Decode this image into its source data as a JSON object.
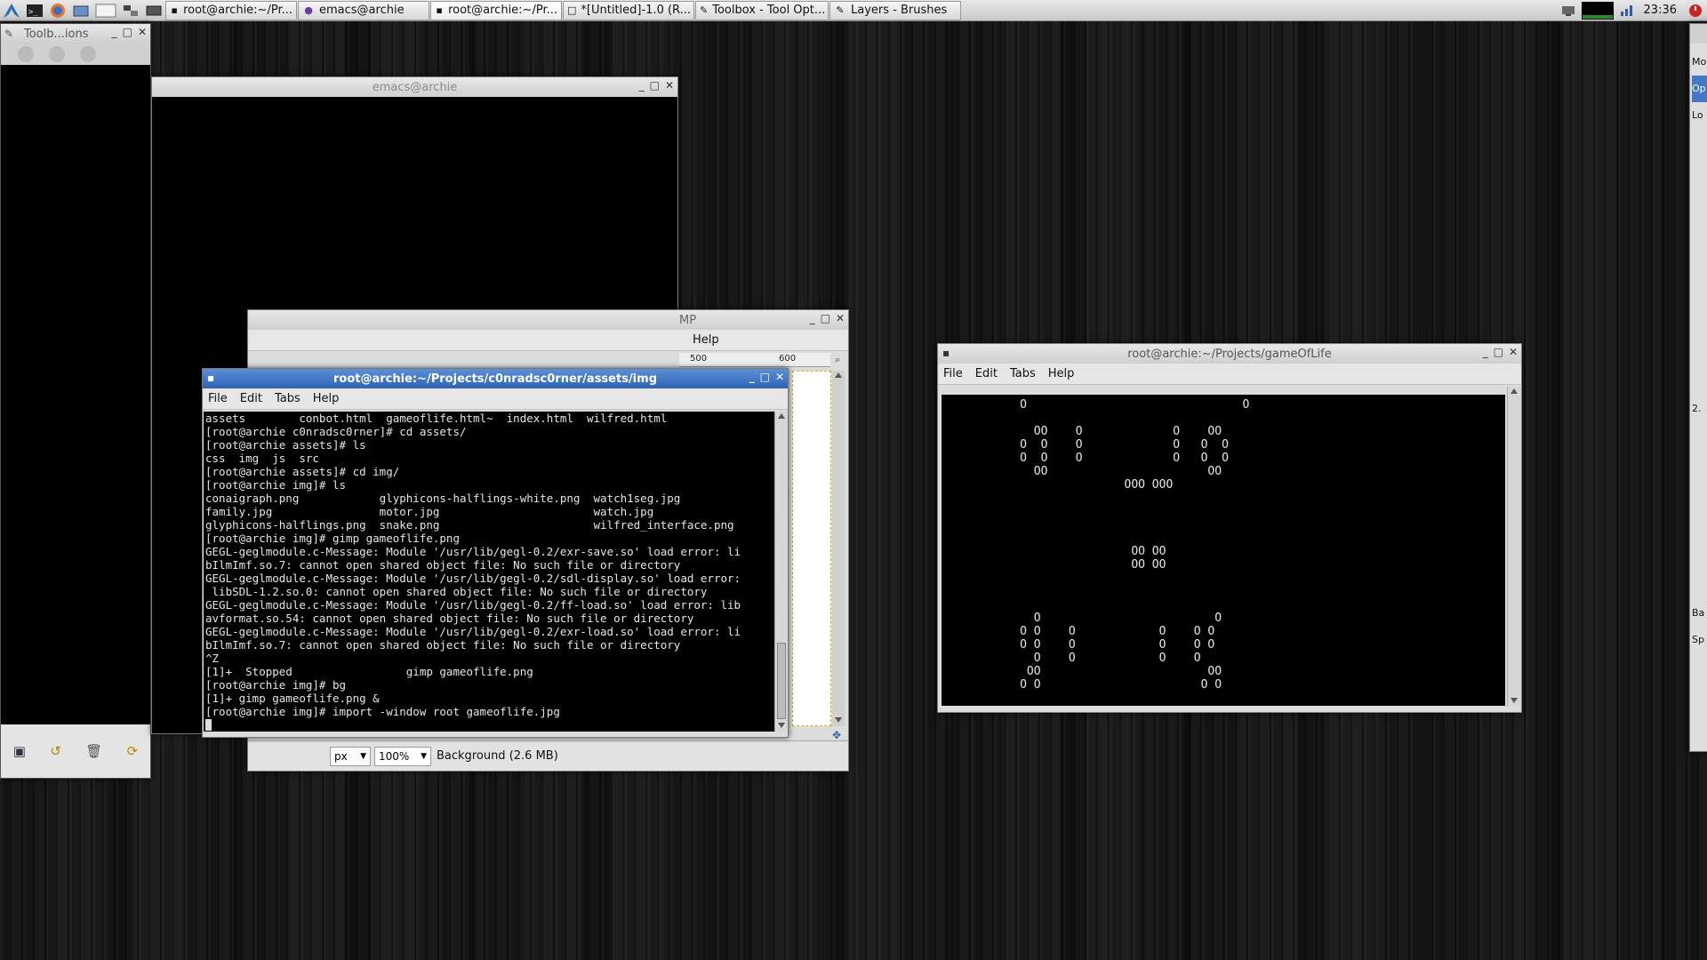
{
  "taskbar": {
    "tasks": [
      {
        "label": "root@archie:~/Pr..."
      },
      {
        "label": "emacs@archie"
      },
      {
        "label": "root@archie:~/Pr..."
      },
      {
        "label": "*[Untitled]-1.0 (R..."
      },
      {
        "label": "Toolbox - Tool Opt..."
      },
      {
        "label": "Layers - Brushes"
      }
    ],
    "clock": "23:36"
  },
  "toolbox_window": {
    "title": "Toolb...ions"
  },
  "emacs_window": {
    "title": "emacs@archie"
  },
  "gimp_partial": {
    "title": "MP",
    "menu_help": "Help",
    "ruler": [
      "500",
      "600"
    ],
    "unit": "px",
    "zoom": "100%",
    "layer_info": "Background (2.6 MB)"
  },
  "terminal_assets": {
    "title": "root@archie:~/Projects/c0nradsc0rner/assets/img",
    "menu": [
      "File",
      "Edit",
      "Tabs",
      "Help"
    ],
    "lines": [
      "assets        conbot.html  gameoflife.html~  index.html  wilfred.html",
      "[root@archie c0nradsc0rner]# cd assets/",
      "[root@archie assets]# ls",
      "css  img  js  src",
      "[root@archie assets]# cd img/",
      "[root@archie img]# ls",
      "conaigraph.png            glyphicons-halflings-white.png  watch1seg.jpg",
      "family.jpg                motor.jpg                       watch.jpg",
      "glyphicons-halflings.png  snake.png                       wilfred_interface.png",
      "[root@archie img]# gimp gameoflife.png",
      "GEGL-geglmodule.c-Message: Module '/usr/lib/gegl-0.2/exr-save.so' load error: li",
      "bIlmImf.so.7: cannot open shared object file: No such file or directory",
      "GEGL-geglmodule.c-Message: Module '/usr/lib/gegl-0.2/sdl-display.so' load error:",
      " libSDL-1.2.so.0: cannot open shared object file: No such file or directory",
      "GEGL-geglmodule.c-Message: Module '/usr/lib/gegl-0.2/ff-load.so' load error: lib",
      "avformat.so.54: cannot open shared object file: No such file or directory",
      "GEGL-geglmodule.c-Message: Module '/usr/lib/gegl-0.2/exr-load.so' load error: li",
      "bIlmImf.so.7: cannot open shared object file: No such file or directory",
      "^Z",
      "[1]+  Stopped                 gimp gameoflife.png",
      "[root@archie img]# bg",
      "[1]+ gimp gameoflife.png &",
      "[root@archie img]# import -window root gameoflife.jpg"
    ]
  },
  "terminal_gol": {
    "title": "root@archie:~/Projects/gameOfLife",
    "menu": [
      "File",
      "Edit",
      "Tabs",
      "Help"
    ],
    "lines": [
      "           O                               O",
      "",
      "             OO    O             O    OO",
      "           O  O    O             O   O  O",
      "           O  O    O             O   O  O",
      "             OO                       OO",
      "                          OOO OOO",
      "",
      "",
      "",
      "",
      "                           OO OO",
      "                           OO OO",
      "",
      "",
      "",
      "             O                         O",
      "           O O    O            O    O O",
      "           O O    O            O    O O",
      "             O    O            O    O",
      "            OO                        OO",
      "           O O                       O O"
    ]
  },
  "right_panel": {
    "labels": [
      "Mo",
      "Op",
      "Lo",
      "2.",
      "Ba",
      "Sp"
    ]
  }
}
